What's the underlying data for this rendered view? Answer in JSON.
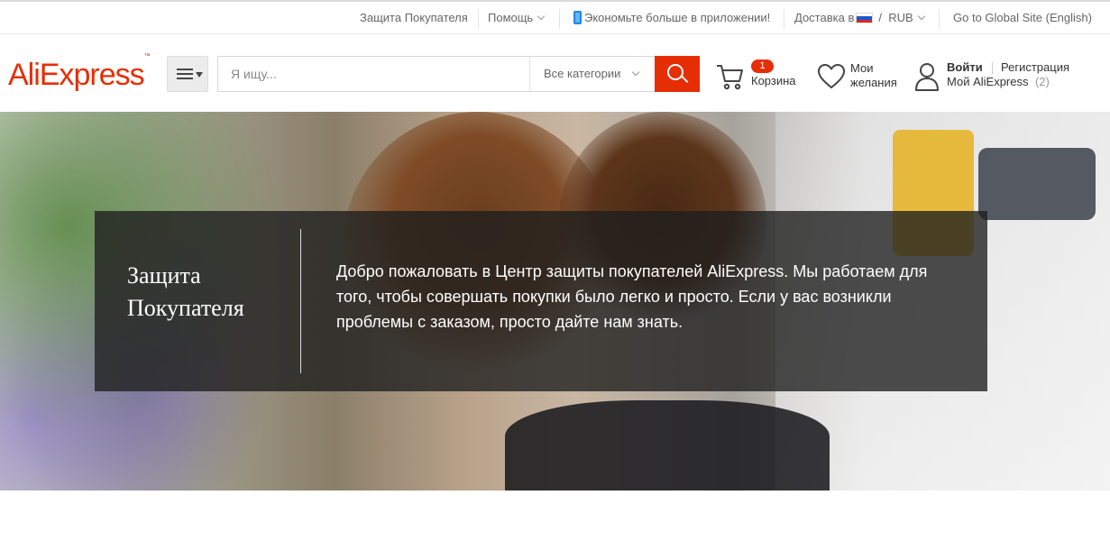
{
  "topbar": {
    "buyer_protection": "Защита Покупателя",
    "help": "Помощь",
    "app_promo": "Экономьте больше в приложении!",
    "delivery_label": "Доставка в",
    "currency_sep": "/",
    "currency": "RUB",
    "global_site": "Go to Global Site (English)"
  },
  "header": {
    "logo": "AliExpress",
    "logo_tm": "™",
    "search_placeholder": "Я ищу...",
    "category_label": "Все категории",
    "cart_count": "1",
    "cart_label": "Корзина",
    "wishlist_line1": "Мои",
    "wishlist_line2": "желания",
    "signin": "Войти",
    "register": "Регистрация",
    "my_account": "Мой AliExpress",
    "my_account_count": "(2)"
  },
  "hero": {
    "title": "Защита Покупателя",
    "description": "Добро пожаловать в Центр защиты покупателей AliExpress. Мы работаем для того, чтобы совершать покупки было легко и просто. Если у вас возникли проблемы с заказом, просто дайте нам знать."
  },
  "colors": {
    "brand": "#e62e04",
    "overlay": "rgba(30,30,30,0.78)",
    "app_icon": "#1e88e5"
  },
  "icons": {
    "menu": "hamburger-icon",
    "search": "magnifier-icon",
    "cart": "cart-icon",
    "wishlist": "heart-icon",
    "account": "user-icon",
    "phone": "phone-icon",
    "flag": "russia-flag-icon"
  }
}
